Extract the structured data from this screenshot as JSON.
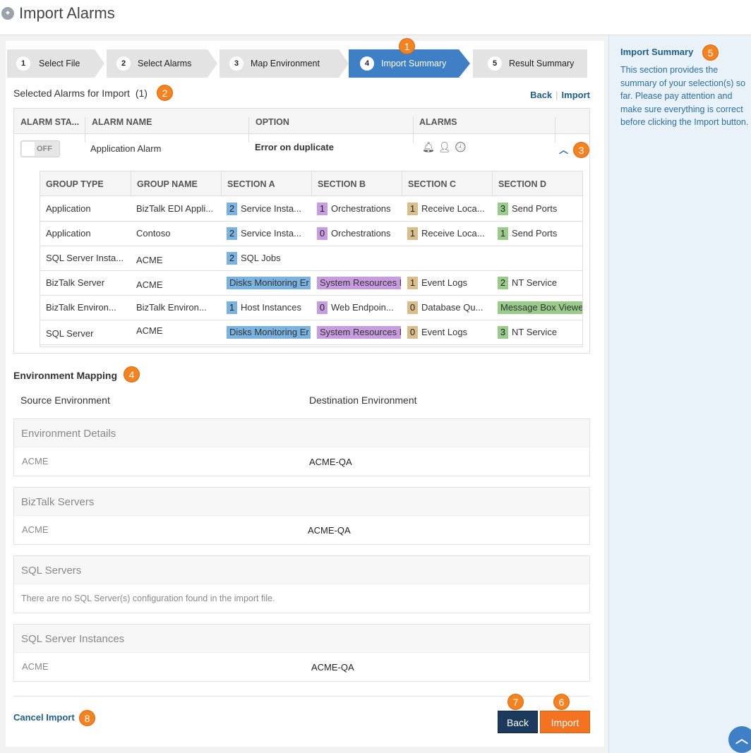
{
  "page": {
    "title": "Import Alarms"
  },
  "wizard": {
    "steps": [
      {
        "num": "1",
        "label": "Select File"
      },
      {
        "num": "2",
        "label": "Select Alarms"
      },
      {
        "num": "3",
        "label": "Map Environment"
      },
      {
        "num": "4",
        "label": "Import Summary"
      },
      {
        "num": "5",
        "label": "Result Summary"
      }
    ],
    "active_step": 4
  },
  "selected": {
    "title": "Selected Alarms for Import",
    "count": "(1)",
    "back_link": "Back",
    "import_link": "Import"
  },
  "alarm_table": {
    "headers": [
      "ALARM STA...",
      "ALARM NAME",
      "OPTION",
      "ALARMS"
    ],
    "row": {
      "toggle": "OFF",
      "name": "Application Alarm",
      "option": "Error on duplicate",
      "icons": [
        "bell-icon",
        "user-icon",
        "clock-icon"
      ]
    }
  },
  "groups": {
    "headers": [
      "GROUP TYPE",
      "GROUP NAME",
      "SECTION A",
      "SECTION B",
      "SECTION C",
      "SECTION D"
    ],
    "rows": [
      {
        "type": "Application",
        "name": "BizTalk EDI Appli...",
        "a": {
          "n": "2",
          "t": "Service Insta..."
        },
        "b": {
          "n": "1",
          "t": "Orchestrations"
        },
        "c": {
          "n": "1",
          "t": "Receive Loca..."
        },
        "d": {
          "n": "3",
          "t": "Send Ports"
        }
      },
      {
        "type": "Application",
        "name": "Contoso",
        "a": {
          "n": "2",
          "t": "Service Insta..."
        },
        "b": {
          "n": "0",
          "t": "Orchestrations"
        },
        "c": {
          "n": "1",
          "t": "Receive Loca..."
        },
        "d": {
          "n": "1",
          "t": "Send Ports"
        }
      },
      {
        "type": "SQL Server Insta...",
        "name": "ACME",
        "a": {
          "n": "2",
          "t": "SQL Jobs"
        }
      },
      {
        "type": "BizTalk Server",
        "name": "ACME",
        "a": {
          "t": "Disks Monitoring Er"
        },
        "b": {
          "t": "System Resources M"
        },
        "c": {
          "n": "1",
          "t": "Event Logs"
        },
        "d": {
          "n": "2",
          "t": "NT Service"
        }
      },
      {
        "type": "BizTalk Environ...",
        "name": "BizTalk Environ...",
        "a": {
          "n": "1",
          "t": "Host Instances"
        },
        "b": {
          "n": "0",
          "t": "Web Endpoin..."
        },
        "c": {
          "n": "0",
          "t": "Database Qu..."
        },
        "d": {
          "t": "Message Box Viewe"
        }
      },
      {
        "type": "SQL Server",
        "name": "ACME",
        "a": {
          "t": "Disks Monitoring Er"
        },
        "b": {
          "t": "System Resources M"
        },
        "c": {
          "n": "0",
          "t": "Event Logs"
        },
        "d": {
          "n": "3",
          "t": "NT Service"
        }
      }
    ]
  },
  "colors": {
    "a": "#7ab3e0",
    "b": "#c79de0",
    "c": "#d9bd8a",
    "d": "#9acb8a",
    "accent": "#f58220",
    "active_step": "#3f7fc6"
  },
  "env": {
    "title": "Environment Mapping",
    "source_label": "Source Environment",
    "dest_label": "Destination Environment",
    "sections": [
      {
        "title": "Environment Details",
        "source": "ACME",
        "dest": "ACME-QA"
      },
      {
        "title": "BizTalk Servers",
        "source": "ACME",
        "dest": "ACME-QA"
      },
      {
        "title": "SQL Servers",
        "message": "There are no SQL Server(s) configuration found in the import file."
      },
      {
        "title": "SQL Server Instances",
        "source": "ACME",
        "dest": "ACME-QA"
      }
    ]
  },
  "footer": {
    "cancel": "Cancel Import",
    "back": "Back",
    "import": "Import"
  },
  "sidebar": {
    "title": "Import Summary",
    "text": "This section provides the summary of your selection(s) so far. Please pay attention and make sure everything is correct before clicking the Import button."
  },
  "callouts": [
    "1",
    "2",
    "3",
    "4",
    "5",
    "6",
    "7",
    "8"
  ]
}
